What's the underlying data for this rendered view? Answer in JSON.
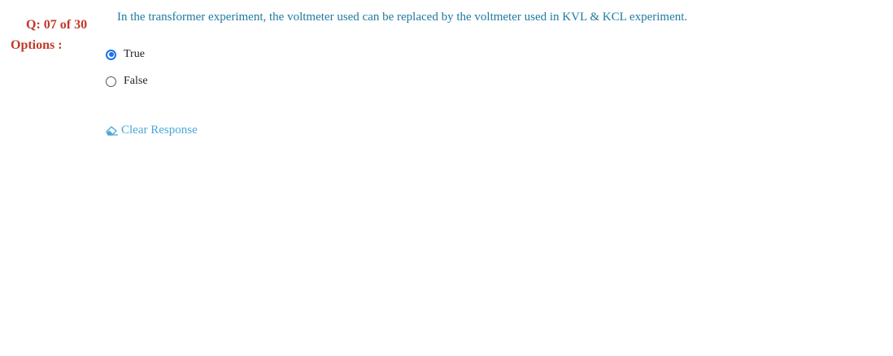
{
  "question": {
    "number_label": "Q: 07 of 30",
    "options_label": "Options :",
    "text": "In the transformer experiment, the voltmeter used can be replaced by the voltmeter used in KVL & KCL experiment."
  },
  "options": [
    {
      "label": "True",
      "selected": true
    },
    {
      "label": "False",
      "selected": false
    }
  ],
  "actions": {
    "clear_response_label": "Clear Response",
    "clear_response_icon": "eraser-icon"
  },
  "colors": {
    "accent_red": "#c0392b",
    "question_blue": "#1e7aa0",
    "link_blue": "#4aa8d8",
    "radio_blue": "#1a73e8"
  }
}
